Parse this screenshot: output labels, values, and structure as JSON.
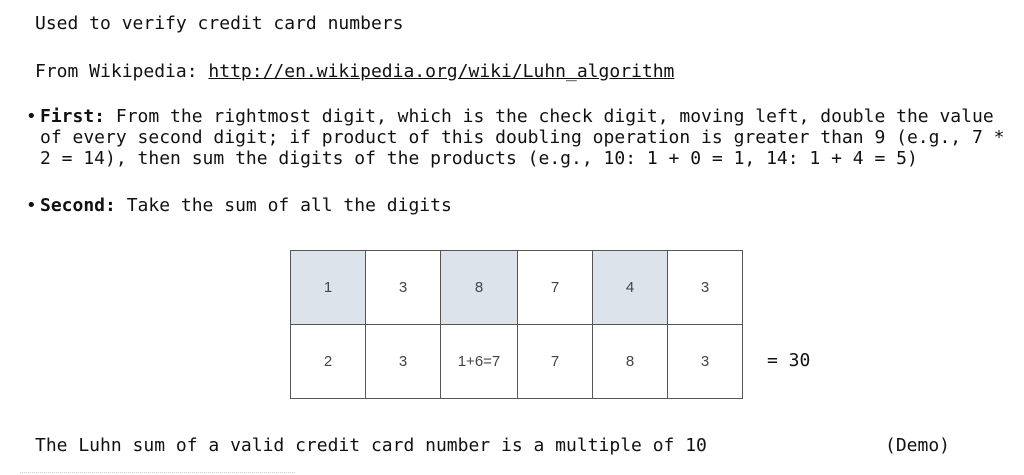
{
  "intro": "Used to verify credit card numbers",
  "source": {
    "prefix": "From Wikipedia: ",
    "link_text": "http://en.wikipedia.org/wiki/Luhn_algorithm"
  },
  "bullets": [
    {
      "label": "First:",
      "text": " From the rightmost digit, which is the check digit, moving left, double the value of every second digit; if product of this doubling operation is greater than 9 (e.g., 7 * 2 = 14), then sum the digits of the products (e.g., 10: 1 + 0 = 1, 14: 1 + 4 = 5)"
    },
    {
      "label": "Second:",
      "text": " Take the sum of all the digits"
    }
  ],
  "digits_table": {
    "top_row": [
      "1",
      "3",
      "8",
      "7",
      "4",
      "3"
    ],
    "bottom_row": [
      "2",
      "3",
      "1+6=7",
      "7",
      "8",
      "3"
    ],
    "highlight_color": "#dde3ea"
  },
  "sum_text": "= 30",
  "conclusion": "The Luhn sum of a valid credit card number is a multiple of 10",
  "demo_label": "(Demo)"
}
